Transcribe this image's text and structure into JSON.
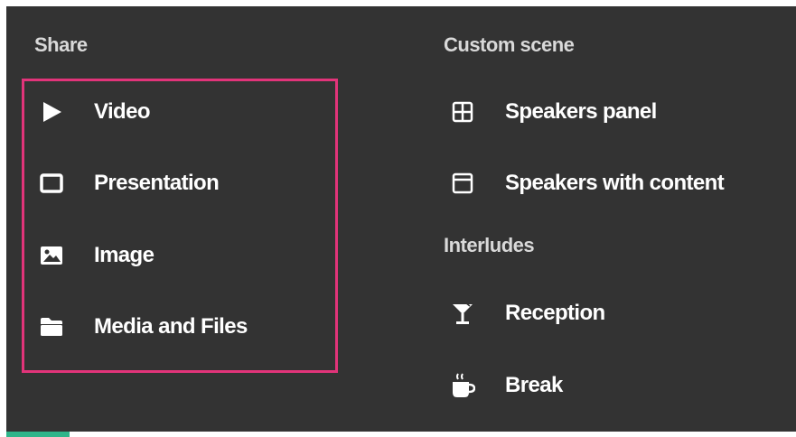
{
  "share": {
    "title": "Share",
    "items": [
      {
        "label": "Video",
        "icon": "play-icon"
      },
      {
        "label": "Presentation",
        "icon": "screen-icon"
      },
      {
        "label": "Image",
        "icon": "image-icon"
      },
      {
        "label": "Media and Files",
        "icon": "folder-icon"
      }
    ]
  },
  "custom_scene": {
    "title": "Custom scene",
    "items": [
      {
        "label": "Speakers panel",
        "icon": "grid-icon"
      },
      {
        "label": "Speakers with content",
        "icon": "layout-icon"
      }
    ]
  },
  "interludes": {
    "title": "Interludes",
    "items": [
      {
        "label": "Reception",
        "icon": "cocktail-icon"
      },
      {
        "label": "Break",
        "icon": "coffee-icon"
      }
    ]
  },
  "colors": {
    "panel_bg": "#333333",
    "highlight": "#e2347a",
    "accent": "#2fb58a"
  }
}
